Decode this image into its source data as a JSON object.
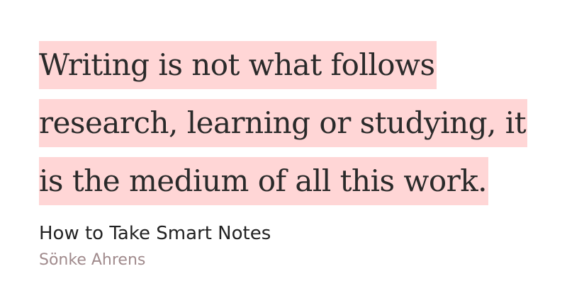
{
  "quote": {
    "lines": [
      "Writing is not what follows",
      "research, learning or studying, it",
      "is the medium of all this work."
    ]
  },
  "source": {
    "book_title": "How to Take Smart Notes",
    "author": "Sönke Ahrens"
  },
  "colors": {
    "highlight": "#ffd6d6",
    "quote_text": "#2a2a2a",
    "title_text": "#222222",
    "author_text": "#a08a8c",
    "background": "#ffffff"
  }
}
